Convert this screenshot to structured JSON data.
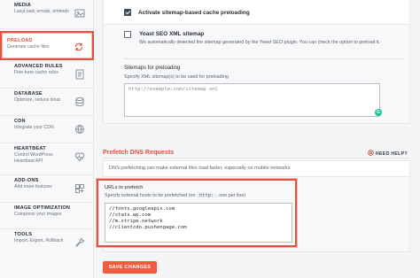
{
  "sidebar": {
    "items": [
      {
        "title": "MEDIA",
        "subtitle": "LazyLoad, emojis, embeds",
        "icon": "media-icon"
      },
      {
        "title": "PRELOAD",
        "subtitle": "Generate cache files",
        "icon": "refresh-icon"
      },
      {
        "title": "ADVANCED RULES",
        "subtitle": "Fine-tune cache rules",
        "icon": "rules-icon"
      },
      {
        "title": "DATABASE",
        "subtitle": "Optimize, reduce bloat",
        "icon": "database-icon"
      },
      {
        "title": "CDN",
        "subtitle": "Integrate your CDN",
        "icon": "cdn-icon"
      },
      {
        "title": "HEARTBEAT",
        "subtitle": "Control WordPress Heartbeat API",
        "icon": "heartbeat-icon"
      },
      {
        "title": "ADD-ONS",
        "subtitle": "Add more features",
        "icon": "addons-icon"
      },
      {
        "title": "IMAGE OPTIMIZATION",
        "subtitle": "Compress your images",
        "icon": "image-icon"
      },
      {
        "title": "TOOLS",
        "subtitle": "Import, Export, Rollback",
        "icon": "tools-icon"
      }
    ],
    "active_index": 1
  },
  "preload": {
    "sitemap_option_label": "Activate sitemap-based cache preloading",
    "sitemap_option_checked": true,
    "yoast_label": "Yoast SEO XML sitemap",
    "yoast_checked": false,
    "yoast_desc": "We automatically detected the sitemap generated by the Yoast SEO plugin. You can check the option to preload it.",
    "sitemaps_label": "Sitemaps for preloading",
    "sitemaps_desc": "Specify XML sitemap(s) to be used for preloading",
    "sitemaps_placeholder": "http://example.com/sitemap.xml",
    "grammarly_badge": "G"
  },
  "prefetch": {
    "title": "Prefetch DNS Requests",
    "help_label": "NEED HELP?",
    "intro": "DNS prefetching can make external files load faster, especially on mobile networks",
    "urls_label": "URLs to prefetch",
    "urls_desc_before": "Specify external hosts to be prefetched (no",
    "urls_desc_code": "http:",
    "urls_desc_after": ", one per line)",
    "urls": [
      "//fonts.googleapis.com",
      "//stats.wp.com",
      "//m.stripe.network",
      "//clientcdn.pushengage.com"
    ]
  },
  "save_label": "SAVE CHANGES",
  "colors": {
    "accent": "#e05241",
    "button": "#f15a3e",
    "highlight_border": "#e05241"
  }
}
